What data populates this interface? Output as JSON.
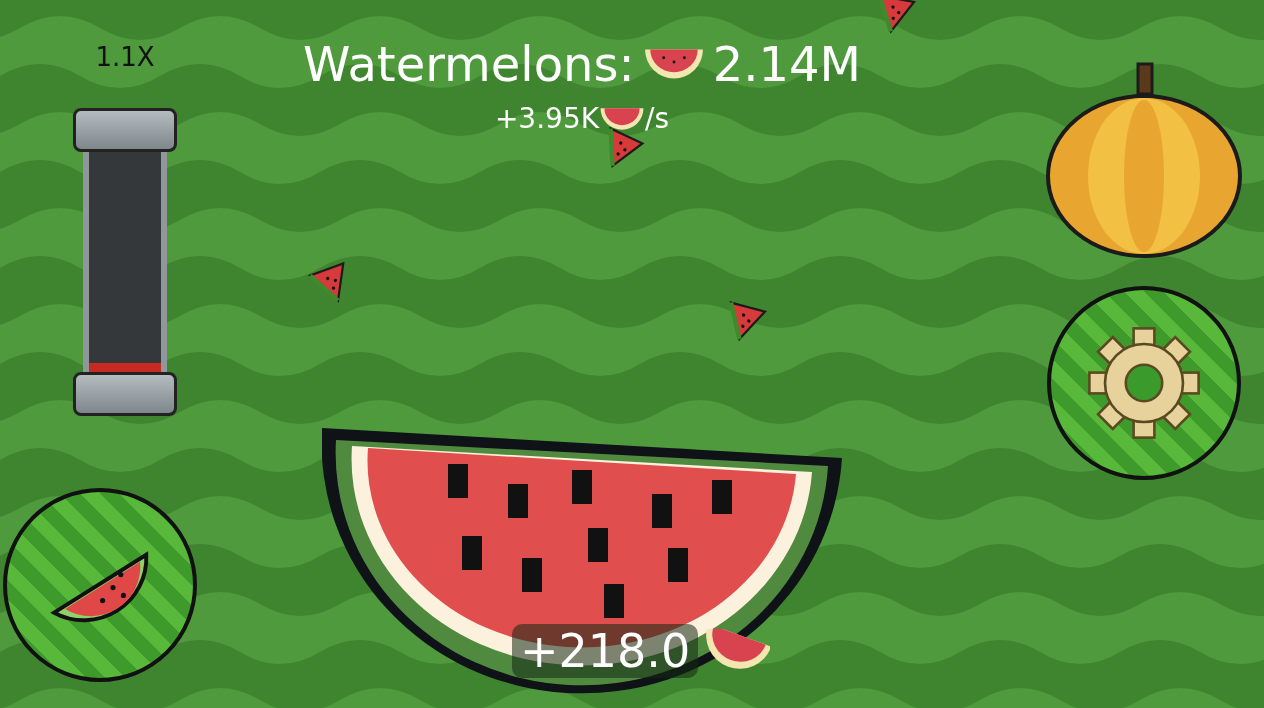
{
  "multiplier": {
    "label": "1.1X",
    "level": 0.04
  },
  "counter": {
    "label": "Watermelons:",
    "value": "2.14M"
  },
  "rate": {
    "value": "+3.95K",
    "unit": "/s"
  },
  "click_popup": {
    "value": "+218.0"
  }
}
